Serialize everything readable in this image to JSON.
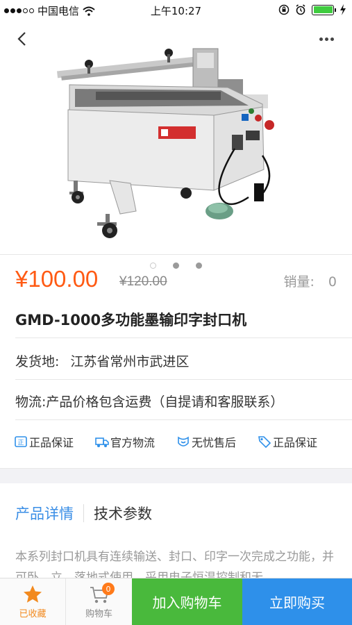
{
  "status_bar": {
    "carrier": "中国电信",
    "time": "上午10:27",
    "battery_color": "#3fcc3f"
  },
  "product": {
    "price": "¥100.00",
    "original_price": "¥120.00",
    "sales_label": "销量:",
    "sales_value": "0",
    "title": "GMD-1000多功能墨输印字封口机",
    "ship_from_label": "发货地:",
    "ship_from_value": "江苏省常州市武进区",
    "logistics_label": "物流:",
    "logistics_value": "产品价格包含运费（自提请和客服联系）",
    "image_count": 3,
    "active_image_index": 0,
    "price_color": "#ff5a13"
  },
  "guarantees": [
    {
      "label": "正品保证",
      "icon": "certificate-icon"
    },
    {
      "label": "官方物流",
      "icon": "truck-icon"
    },
    {
      "label": "无忧售后",
      "icon": "service-icon"
    },
    {
      "label": "正品保证",
      "icon": "tag-icon"
    }
  ],
  "tabs": {
    "details": "产品详情",
    "specs": "技术参数",
    "active_color": "#3a8ee6"
  },
  "description": "本系列封口机具有连续输送、封口、印字一次完成之功能，并可卧、立、落地式使用，采用电子恒温控制和无",
  "bottom_bar": {
    "favorite_label": "已收藏",
    "cart_label": "购物车",
    "cart_count": "0",
    "add_to_cart_label": "加入购物车",
    "buy_now_label": "立即购买",
    "add_to_cart_color": "#49b93c",
    "buy_now_color": "#2e90ea"
  }
}
